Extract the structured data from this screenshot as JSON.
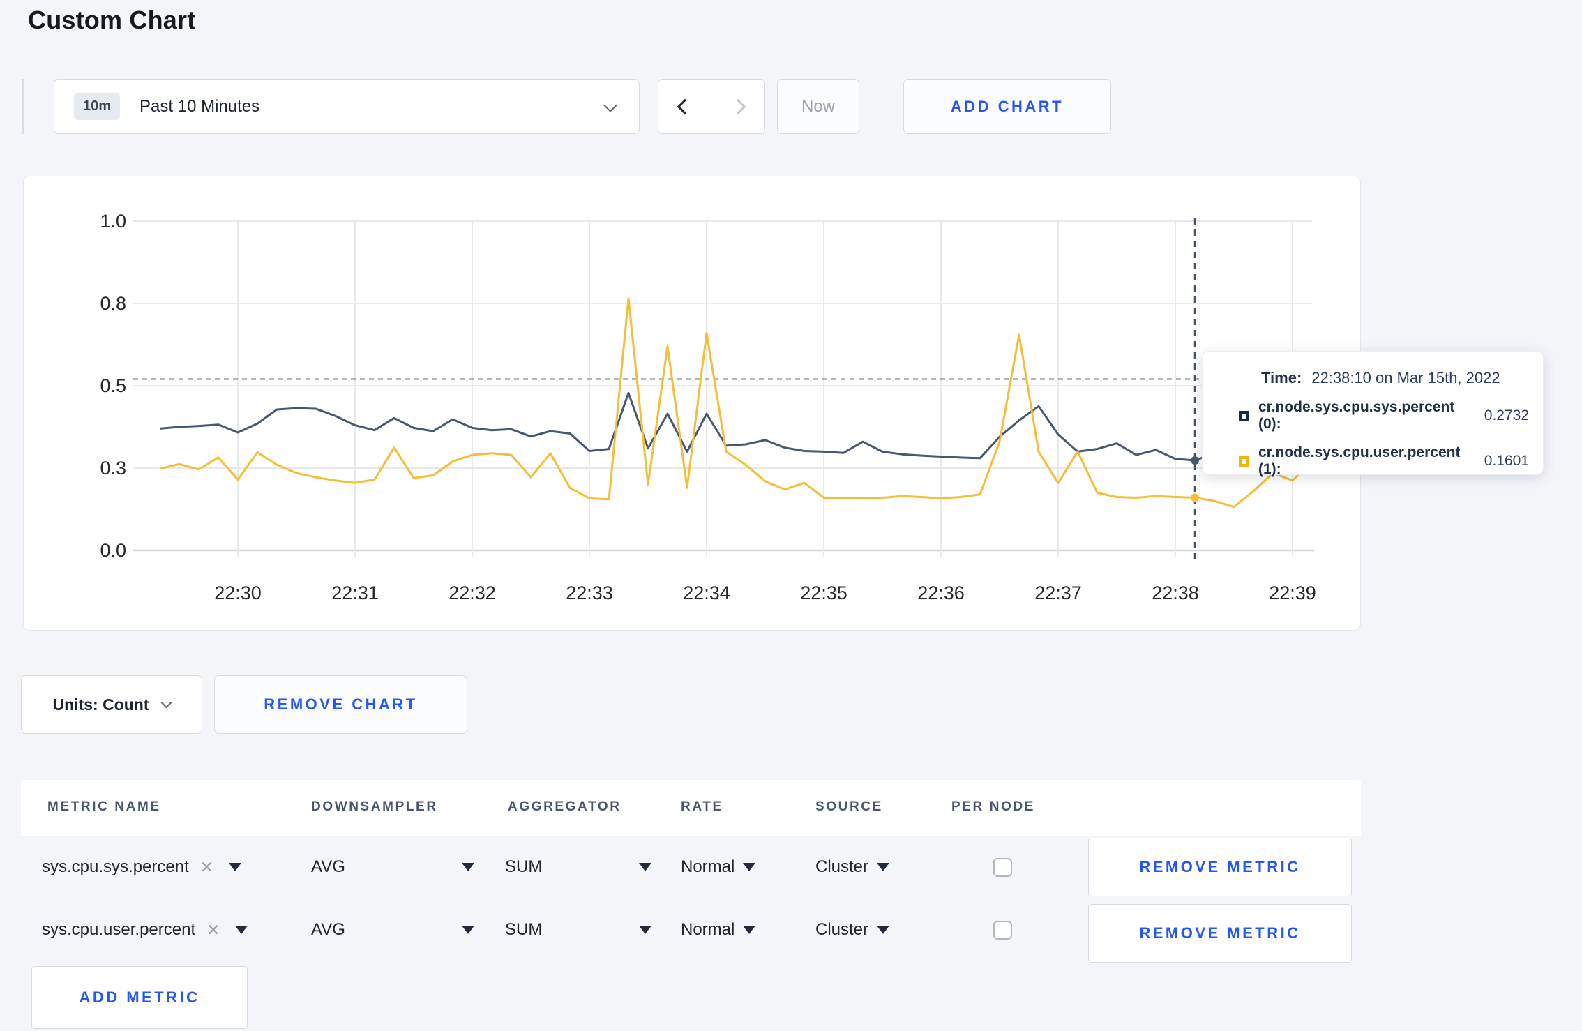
{
  "page": {
    "title": "Custom Chart",
    "accent_blue": "#2557f6",
    "background": "#f4f5f9"
  },
  "toolbar": {
    "range_badge": "10m",
    "range_label": "Past 10 Minutes",
    "now_label": "Now",
    "add_chart_label": "ADD CHART"
  },
  "icons": {
    "remove_x": "✕"
  },
  "chart_data": {
    "type": "line",
    "title": "",
    "xlabel": "",
    "ylabel": "",
    "ylim": [
      0,
      1
    ],
    "grid": true,
    "legend_position": "none",
    "y_tick_values": [
      0,
      0.25,
      0.5,
      0.75,
      1.0
    ],
    "y_tick_labels": [
      "0.0",
      "0.3",
      "0.5",
      "0.8",
      "1.0"
    ],
    "x_tick_labels": [
      "22:30",
      "22:31",
      "22:32",
      "22:33",
      "22:34",
      "22:35",
      "22:36",
      "22:37",
      "22:38",
      "22:39"
    ],
    "x_start_time": "22:29:20",
    "x_step_seconds": 10,
    "series": [
      {
        "name": "cr.node.sys.cpu.sys.percent (0)",
        "color": "#475872",
        "values": [
          0.37,
          0.375,
          0.378,
          0.382,
          0.358,
          0.385,
          0.428,
          0.432,
          0.43,
          0.408,
          0.38,
          0.365,
          0.402,
          0.372,
          0.362,
          0.398,
          0.372,
          0.365,
          0.368,
          0.346,
          0.362,
          0.355,
          0.302,
          0.308,
          0.478,
          0.31,
          0.415,
          0.3,
          0.415,
          0.318,
          0.322,
          0.335,
          0.312,
          0.302,
          0.3,
          0.296,
          0.33,
          0.3,
          0.292,
          0.288,
          0.285,
          0.282,
          0.28,
          0.345,
          0.395,
          0.438,
          0.352,
          0.3,
          0.308,
          0.325,
          0.29,
          0.305,
          0.278,
          0.2732,
          0.295,
          0.3,
          0.295,
          0.305,
          0.298,
          0.302
        ]
      },
      {
        "name": "cr.node.sys.cpu.user.percent (1)",
        "color": "#f5bd38",
        "values": [
          0.248,
          0.262,
          0.246,
          0.282,
          0.215,
          0.298,
          0.26,
          0.235,
          0.222,
          0.212,
          0.205,
          0.215,
          0.312,
          0.22,
          0.228,
          0.27,
          0.29,
          0.295,
          0.29,
          0.222,
          0.295,
          0.19,
          0.158,
          0.155,
          0.765,
          0.2,
          0.62,
          0.19,
          0.66,
          0.3,
          0.26,
          0.21,
          0.185,
          0.205,
          0.16,
          0.158,
          0.158,
          0.16,
          0.165,
          0.162,
          0.158,
          0.162,
          0.17,
          0.33,
          0.655,
          0.3,
          0.205,
          0.3,
          0.175,
          0.162,
          0.16,
          0.165,
          0.162,
          0.1601,
          0.15,
          0.132,
          0.18,
          0.235,
          0.212,
          0.27
        ]
      }
    ],
    "crosshair": {
      "point_index": 53,
      "time": "22:38:10",
      "h_line_value": 0.52,
      "marker_values": [
        0.2732,
        0.1601
      ]
    }
  },
  "tooltip": {
    "time_label": "Time:",
    "time_value": "22:38:10 on Mar 15th, 2022",
    "rows": [
      {
        "label": "cr.node.sys.cpu.sys.percent (0):",
        "value": "0.2732",
        "color": "#1b2b4d"
      },
      {
        "label": "cr.node.sys.cpu.user.percent (1):",
        "value": "0.1601",
        "color": "#f1b60d"
      }
    ]
  },
  "chart_controls": {
    "units_label": "Units: Count",
    "remove_chart_label": "REMOVE CHART"
  },
  "metrics_table": {
    "headers": [
      "METRIC NAME",
      "DOWNSAMPLER",
      "AGGREGATOR",
      "RATE",
      "SOURCE",
      "PER NODE"
    ],
    "rows": [
      {
        "metric": "sys.cpu.sys.percent",
        "downsampler": "AVG",
        "aggregator": "SUM",
        "rate": "Normal",
        "source": "Cluster",
        "per_node": false,
        "remove_label": "REMOVE METRIC"
      },
      {
        "metric": "sys.cpu.user.percent",
        "downsampler": "AVG",
        "aggregator": "SUM",
        "rate": "Normal",
        "source": "Cluster",
        "per_node": false,
        "remove_label": "REMOVE METRIC"
      }
    ],
    "add_metric_label": "ADD METRIC"
  }
}
